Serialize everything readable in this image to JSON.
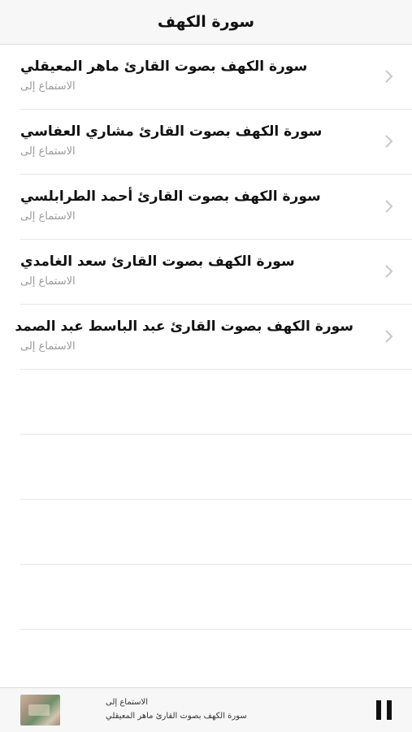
{
  "header": {
    "title": "سورة الكهف"
  },
  "list": {
    "items": [
      {
        "title": "سورة الكهف بصوت القارئ ماهر المعيقلي",
        "subtitle": "الاستماع إلى"
      },
      {
        "title": "سورة الكهف بصوت القارئ مشاري العفاسي",
        "subtitle": "الاستماع إلى"
      },
      {
        "title": "سورة الكهف بصوت القارئ أحمد الطرابلسي",
        "subtitle": "الاستماع إلى"
      },
      {
        "title": "سورة الكهف بصوت القارئ سعد الغامدي",
        "subtitle": "الاستماع إلى"
      },
      {
        "title": "سورة الكهف بصوت القارئ عبد الباسط عبد الصمد",
        "subtitle": "الاستماع إلى"
      }
    ],
    "row_icon": "chevron-right-icon"
  },
  "player": {
    "subtitle": "الاستماع إلى",
    "title": "سورة الكهف بصوت القارئ ماهر المعيقلي",
    "control_icon": "pause-icon"
  }
}
